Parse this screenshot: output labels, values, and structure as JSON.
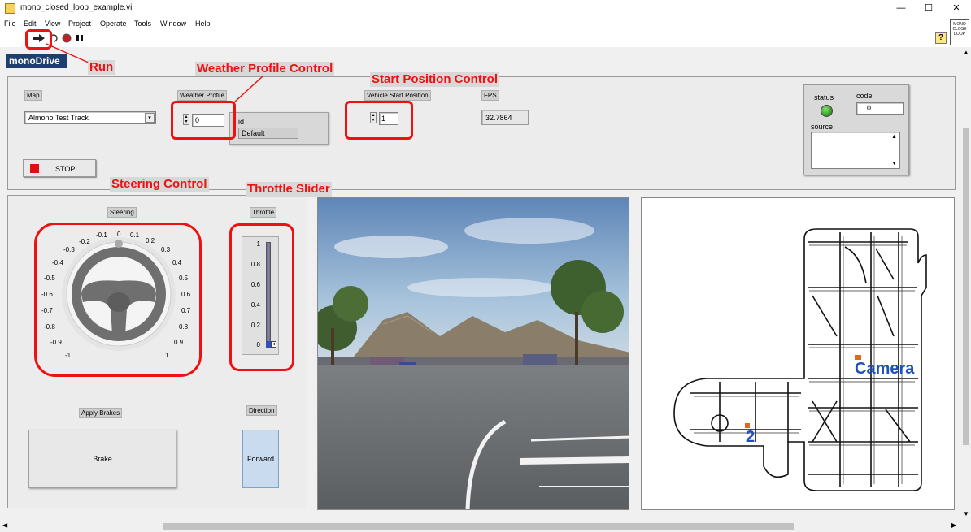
{
  "window": {
    "title": "mono_closed_loop_example.vi",
    "minimize": "—",
    "maximize": "☐",
    "close": "✕"
  },
  "menu": [
    "File",
    "Edit",
    "View",
    "Project",
    "Operate",
    "Tools",
    "Window",
    "Help"
  ],
  "toolbar": {
    "run_icon": "run-arrow-icon",
    "context_help_icon": "?",
    "vi_icon_text": "MONO CLOSE LOOP"
  },
  "brand": "monoDrive",
  "annotations": {
    "run": "Run",
    "weather": "Weather Profile Control",
    "start_position": "Start Position Control",
    "steering": "Steering Control",
    "throttle": "Throttle Slider"
  },
  "controls": {
    "map_label": "Map",
    "map_value": "Almono Test Track",
    "weather_label": "Weather Profile",
    "weather_value": "0",
    "weather_id_label": "id",
    "weather_name": "Default",
    "start_label": "Vehicle Start Position",
    "start_value": "1",
    "fps_label": "FPS",
    "fps_value": "32.7864",
    "stop_label": "STOP",
    "error_status_label": "status",
    "error_code_label": "code",
    "error_code_value": "0",
    "error_source_label": "source"
  },
  "steering": {
    "label": "Steering",
    "ticks": [
      "-1",
      "-0.9",
      "-0.8",
      "-0.7",
      "-0.6",
      "-0.5",
      "-0.4",
      "-0.3",
      "-0.2",
      "-0.1",
      "0",
      "0.1",
      "0.2",
      "0.3",
      "0.4",
      "0.5",
      "0.6",
      "0.7",
      "0.8",
      "0.9",
      "1"
    ],
    "value": 0
  },
  "throttle": {
    "label": "Throttle",
    "ticks": [
      "1",
      "0.8",
      "0.6",
      "0.4",
      "0.2",
      "0"
    ],
    "value": 0
  },
  "brake": {
    "label": "Apply Brakes",
    "button": "Brake"
  },
  "direction": {
    "label": "Direction",
    "button": "Forward"
  },
  "map_view": {
    "camera_label": "Camera",
    "marker_label": "2"
  },
  "colors": {
    "annotation": "#ee1111",
    "brand_bg": "#1e3f6e",
    "map_label": "#1f4fbf",
    "status_led": "#3aa02a",
    "stop_red": "#dd1111"
  }
}
